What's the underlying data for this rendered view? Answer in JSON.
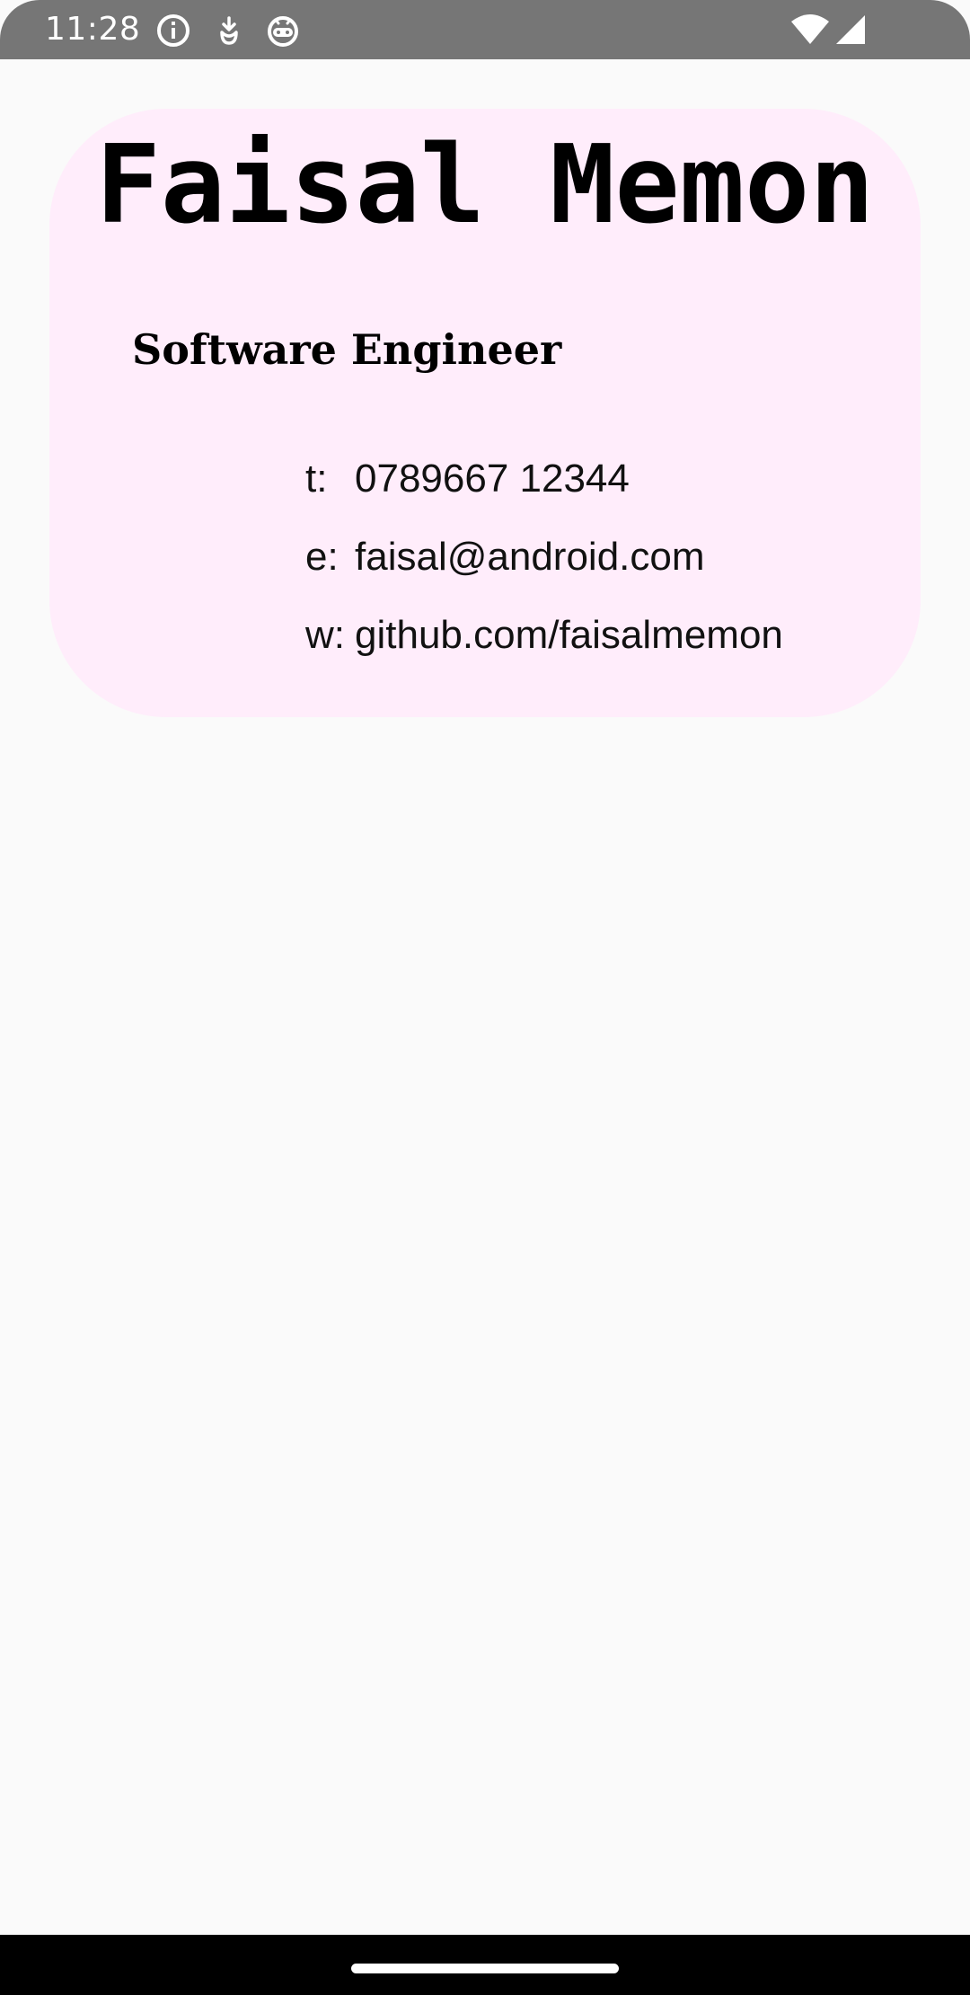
{
  "status_bar": {
    "time": "11:28",
    "icons": [
      "info-icon",
      "download-notification-icon",
      "android-debug-icon",
      "wifi-icon",
      "cellular-signal-icon"
    ]
  },
  "card": {
    "name": "Faisal Memon",
    "job_title": "Software Engineer",
    "background_color": "#ffedfb",
    "contacts": [
      {
        "prefix": "t:",
        "value": "0789667 12344"
      },
      {
        "prefix": "e:",
        "value": "faisal@android.com"
      },
      {
        "prefix": "w:",
        "value": "github.com/faisalmemon"
      }
    ]
  },
  "colors": {
    "status_bar": "#767676",
    "screen_background": "#fafafa",
    "nav_bar": "#000000"
  }
}
